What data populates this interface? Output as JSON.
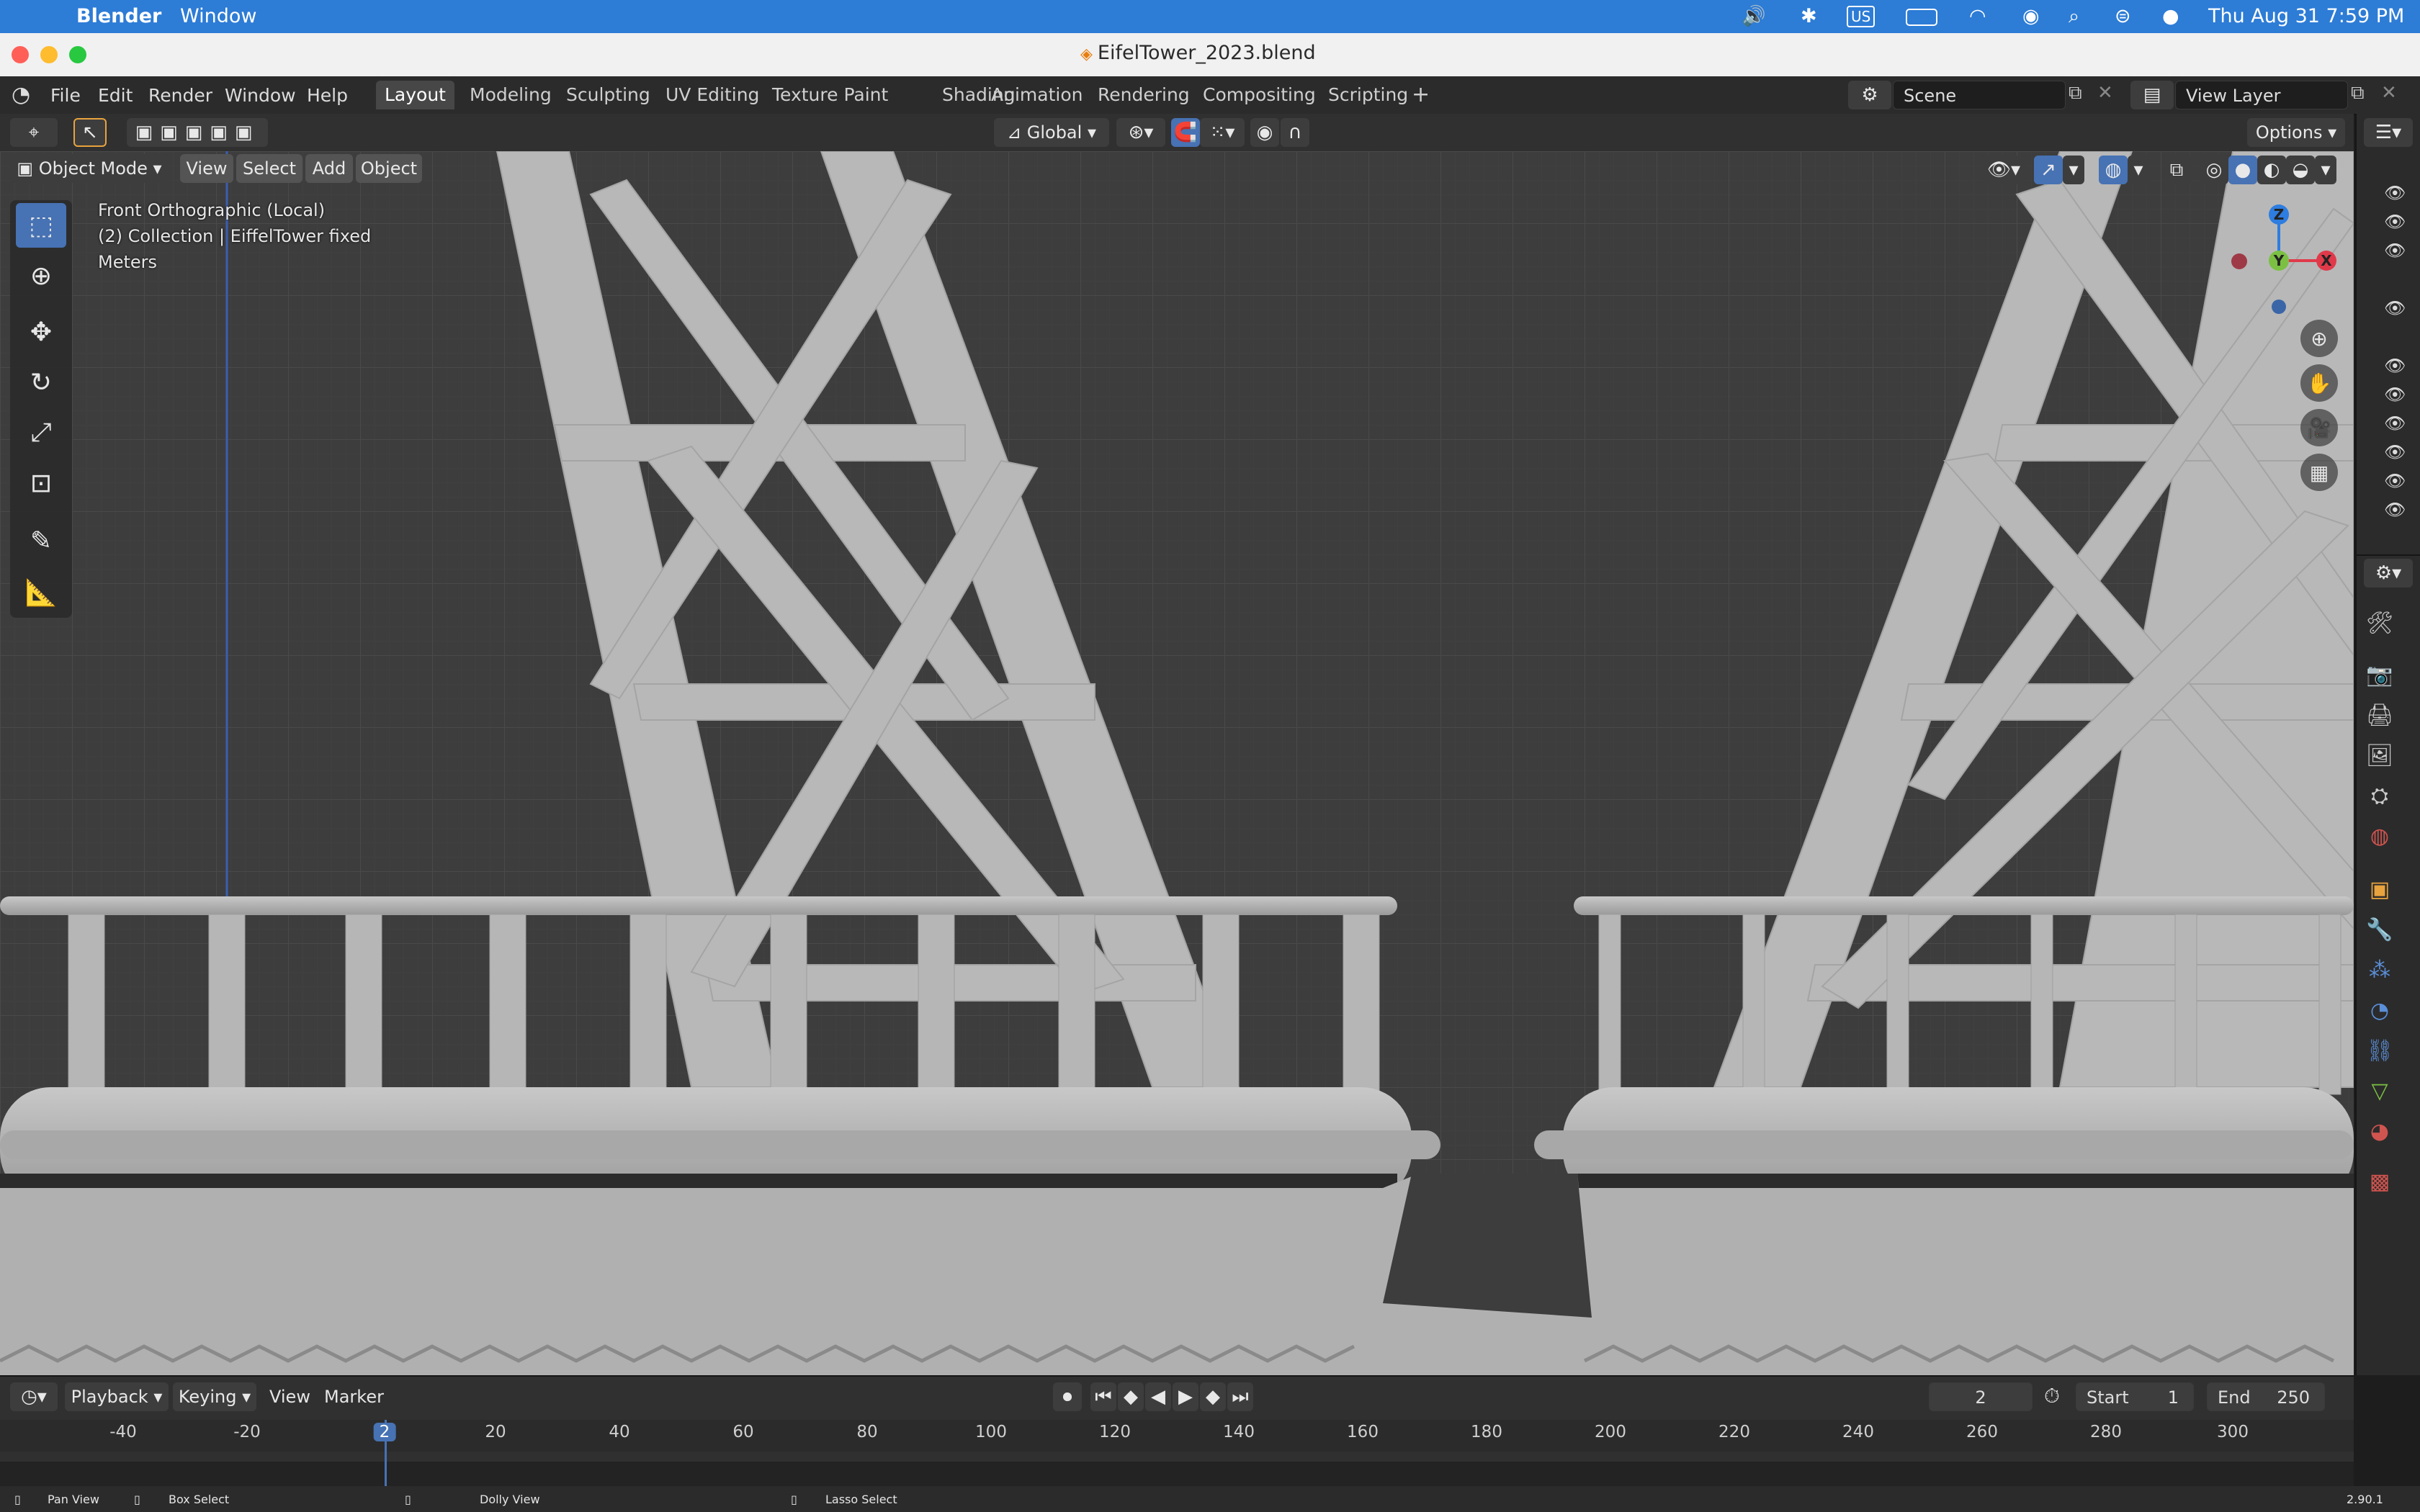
{
  "menubar": {
    "app": "Blender",
    "menu_window": "Window",
    "input_source": "US",
    "datetime": "Thu Aug 31  7:59 PM"
  },
  "window": {
    "title": "EifelTower_2023.blend"
  },
  "topbar": {
    "menus": [
      "File",
      "Edit",
      "Render",
      "Window",
      "Help"
    ],
    "workspaces": [
      "Layout",
      "Modeling",
      "Sculpting",
      "UV Editing",
      "Texture Paint",
      "Shading",
      "Animation",
      "Rendering",
      "Compositing",
      "Scripting"
    ],
    "active_workspace": "Layout",
    "scene": "Scene",
    "view_layer": "View Layer"
  },
  "viewport_header": {
    "transform_orientation": "Global",
    "options_label": "Options",
    "mode": "Object Mode",
    "menus": [
      "View",
      "Select",
      "Add",
      "Object"
    ]
  },
  "overlay": {
    "view_name": "Front Orthographic (Local)",
    "collection": "(2) Collection | EiffelTower fixed",
    "units": "Meters"
  },
  "gizmo": {
    "z": "Z",
    "y": "Y",
    "x": "X"
  },
  "timeline": {
    "playback": "Playback",
    "keying": "Keying",
    "view": "View",
    "marker": "Marker",
    "current_frame": "2",
    "start_label": "Start",
    "start": "1",
    "end_label": "End",
    "end": "250",
    "ruler_ticks": [
      "-40",
      "-20",
      "2",
      "20",
      "40",
      "60",
      "80",
      "100",
      "120",
      "140",
      "160",
      "180",
      "200",
      "220",
      "240",
      "260",
      "280",
      "300"
    ]
  },
  "statusbar": {
    "pan": "Pan View",
    "box": "Box Select",
    "dolly": "Dolly View",
    "lasso": "Lasso Select",
    "version": "2.90.1"
  },
  "colors": {
    "accent": "#4772b3",
    "macos_bar": "#2d7cd6",
    "viewport_bg": "#3d3d3d",
    "model": "#b4b4b4"
  }
}
